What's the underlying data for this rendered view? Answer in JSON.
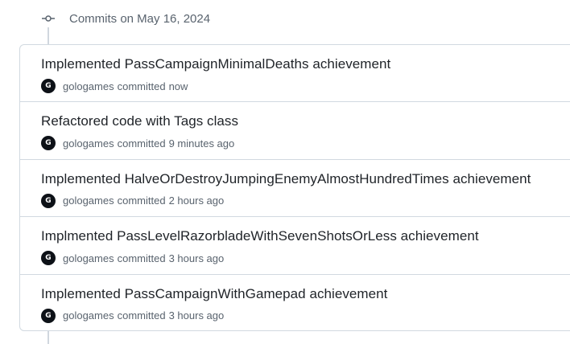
{
  "group": {
    "title": "Commits on May 16, 2024"
  },
  "commits": [
    {
      "title": "Implemented PassCampaignMinimalDeaths achievement",
      "author": "gologames",
      "action": "committed",
      "time": "now",
      "avatar_letter": "G"
    },
    {
      "title": "Refactored code with Tags class",
      "author": "gologames",
      "action": "committed",
      "time": "9 minutes ago",
      "avatar_letter": "G"
    },
    {
      "title": "Implemented HalveOrDestroyJumpingEnemyAlmostHundredTimes achievement",
      "author": "gologames",
      "action": "committed",
      "time": "2 hours ago",
      "avatar_letter": "G"
    },
    {
      "title": "Implmented PassLevelRazorbladeWithSevenShotsOrLess achievement",
      "author": "gologames",
      "action": "committed",
      "time": "3 hours ago",
      "avatar_letter": "G"
    },
    {
      "title": "Implemented PassCampaignWithGamepad achievement",
      "author": "gologames",
      "action": "committed",
      "time": "3 hours ago",
      "avatar_letter": "G"
    }
  ],
  "icons": {
    "group_icon": "git-commit-icon"
  }
}
